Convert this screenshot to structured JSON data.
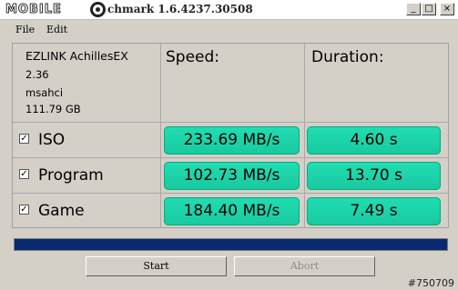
{
  "window": {
    "logo_text": "MOBILE",
    "title": "chmark 1.6.4237.30508",
    "minimize": "_",
    "maximize": "□",
    "close": "×"
  },
  "menu": [
    "File",
    "Edit"
  ],
  "drive": {
    "name": "EZLINK AchillesEX",
    "firmware": "2.36",
    "driver": "msahci",
    "size": "111.79 GB"
  },
  "columns": {
    "speed": "Speed:",
    "duration": "Duration:"
  },
  "tests": [
    {
      "name": "ISO",
      "checked": true,
      "speed": "233.69 MB/s",
      "duration": "4.60 s"
    },
    {
      "name": "Program",
      "checked": true,
      "speed": "102.73 MB/s",
      "duration": "13.70 s"
    },
    {
      "name": "Game",
      "checked": true,
      "speed": "184.40 MB/s",
      "duration": "7.49 s"
    }
  ],
  "progress": {
    "value": 1.0,
    "color": "#0a2a70"
  },
  "buttons": {
    "start": "Start",
    "abort": "Abort"
  },
  "watermark": "#750709",
  "colors": {
    "result_fill": "#22ddb2",
    "background": "#d4d0c8"
  }
}
